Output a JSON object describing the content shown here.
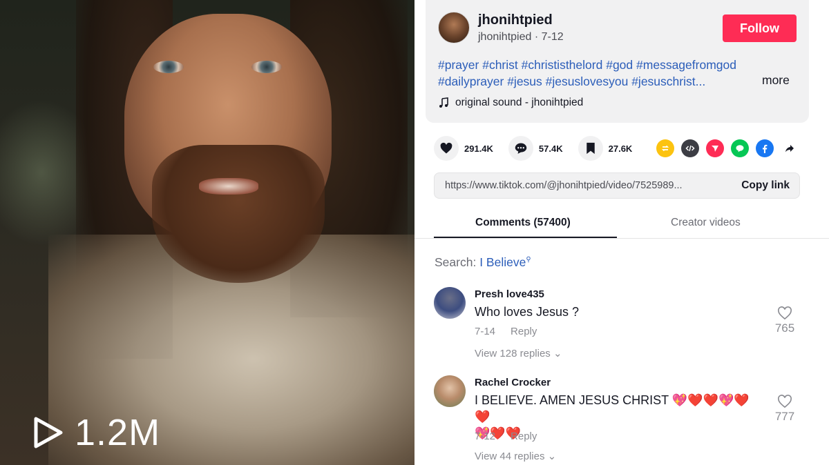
{
  "video": {
    "view_count": "1.2M",
    "play_icon": "play-outline-icon"
  },
  "author": {
    "username": "jhonihtpied",
    "meta": "jhonihtpied · 7-12",
    "follow_label": "Follow"
  },
  "description": {
    "hashtags_line1": [
      "#prayer",
      "#christ",
      "#christisthelord",
      "#god",
      "#messagefromgod"
    ],
    "hashtags_line2": [
      "#dailyprayer",
      "#jesus",
      "#jesuslovesyou",
      "#jesuschrist..."
    ],
    "more_label": "more",
    "sound": "original sound - jhonihtpied"
  },
  "stats": {
    "likes": "291.4K",
    "comments": "57.4K",
    "saves": "27.6K"
  },
  "share_icons": [
    "repost-icon",
    "embed-icon",
    "send-icon",
    "line-icon",
    "facebook-icon",
    "share-arrow-icon"
  ],
  "link": {
    "url": "https://www.tiktok.com/@jhonihtpied/video/7525989...",
    "copy_label": "Copy link"
  },
  "tabs": {
    "comments": "Comments (57400)",
    "creator_videos": "Creator videos"
  },
  "search": {
    "prefix": "Search: ",
    "query": "I Believe"
  },
  "comments": [
    {
      "user": "Presh love435",
      "text": "Who loves Jesus ?",
      "date": "7-14",
      "reply_label": "Reply",
      "view_replies": "View 128 replies",
      "likes": "765"
    },
    {
      "user": "Rachel Crocker",
      "text": "I BELIEVE. AMEN JESUS CHRIST 💖❤️❤️💖❤️❤️",
      "text2": "💖❤️❤️",
      "date": "7-12",
      "reply_label": "Reply",
      "view_replies": "View 44 replies",
      "likes": "777"
    }
  ],
  "colors": {
    "follow": "#fe2c55",
    "hashtag": "#2b5db9",
    "card_bg": "#f1f1f2"
  }
}
